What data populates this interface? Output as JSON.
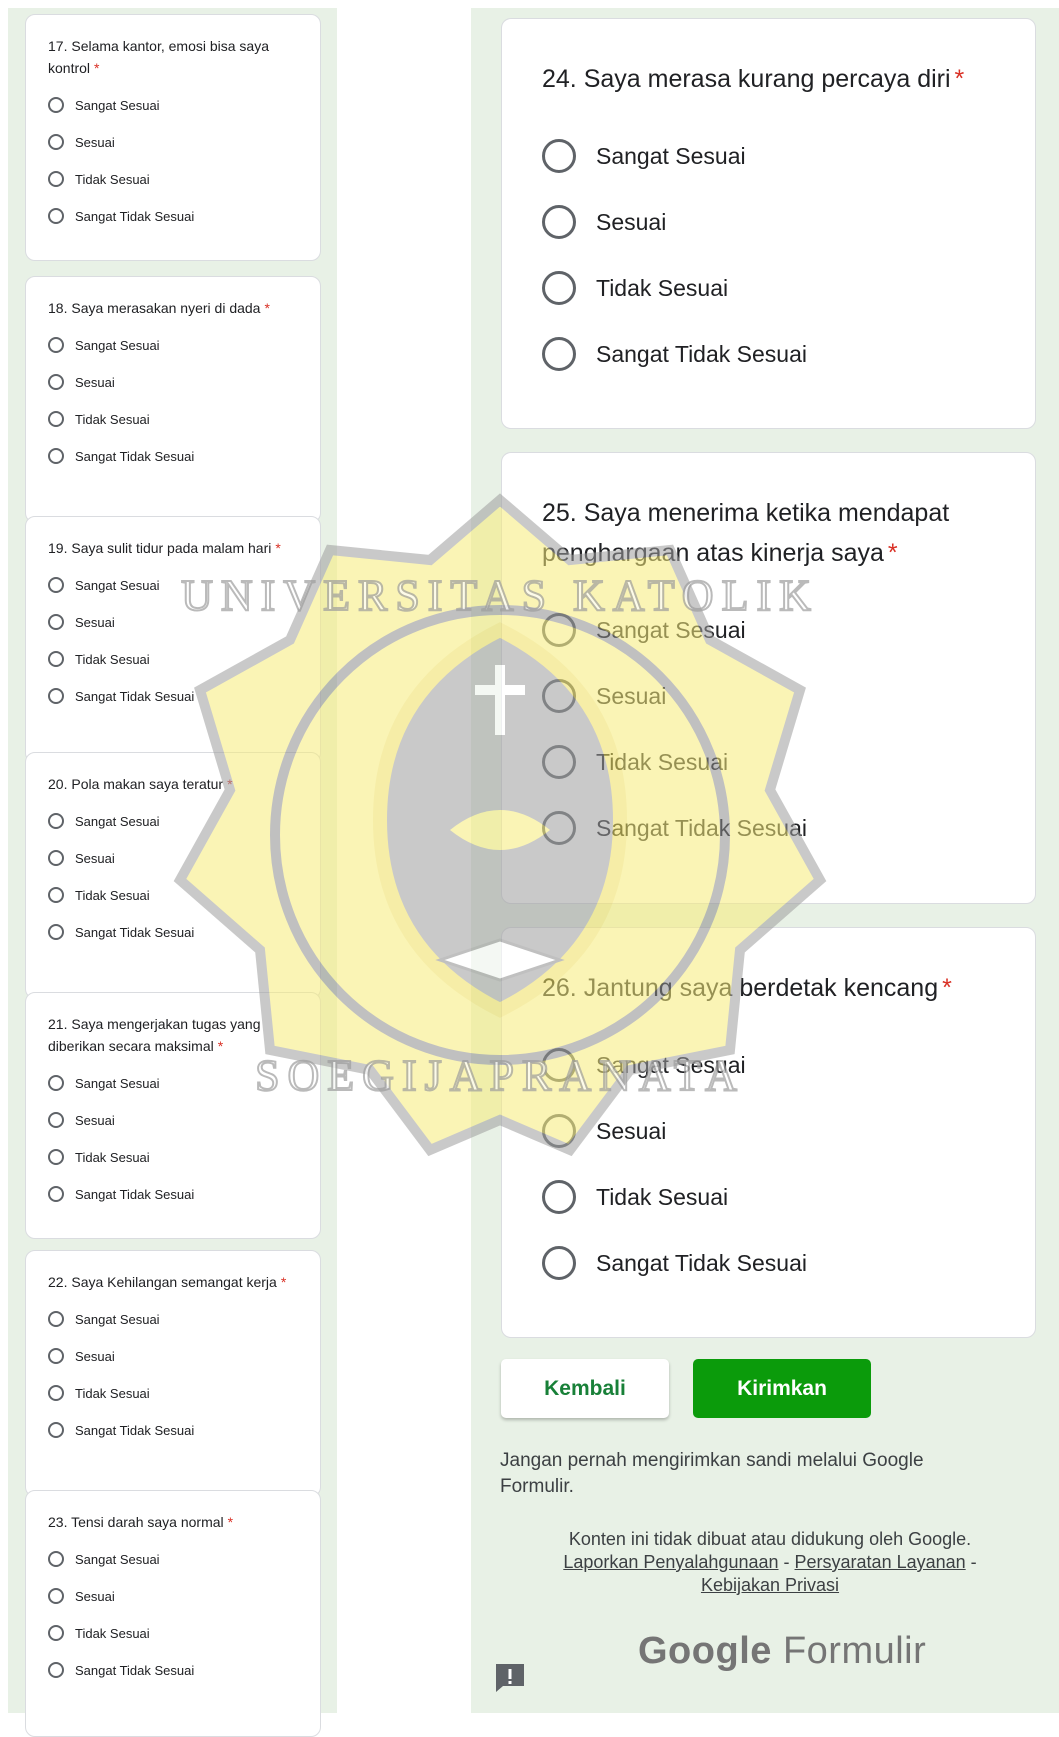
{
  "left_questions": [
    {
      "title_lines": [
        "17. Selama kantor, emosi bisa saya",
        "kontrol"
      ],
      "required": "*"
    },
    {
      "title_lines": [
        "18. Saya merasakan nyeri di dada"
      ],
      "required": "*"
    },
    {
      "title_lines": [
        "19. Saya sulit tidur pada malam hari"
      ],
      "required": "*"
    },
    {
      "title_lines": [
        "20. Pola makan saya teratur"
      ],
      "required": "*"
    },
    {
      "title_lines": [
        "21. Saya mengerjakan tugas yang",
        "diberikan secara maksimal"
      ],
      "required": "*"
    },
    {
      "title_lines": [
        "22. Saya Kehilangan semangat kerja"
      ],
      "required": "*"
    },
    {
      "title_lines": [
        "23. Tensi darah saya normal"
      ],
      "required": "*"
    }
  ],
  "right_questions": [
    {
      "title_lines": [
        "24. Saya merasa kurang percaya diri"
      ],
      "required": "*"
    },
    {
      "title_lines": [
        "25. Saya menerima ketika mendapat",
        "penghargaan atas kinerja saya"
      ],
      "required": "*"
    },
    {
      "title_lines": [
        "26. Jantung saya berdetak kencang"
      ],
      "required": "*"
    }
  ],
  "options": [
    "Sangat Sesuai",
    "Sesuai",
    "Tidak Sesuai",
    "Sangat Tidak Sesuai"
  ],
  "buttons": {
    "back": "Kembali",
    "submit": "Kirimkan"
  },
  "warning": "Jangan pernah mengirimkan sandi melalui Google Formulir.",
  "footer": {
    "disclaimer": "Konten ini tidak dibuat atau didukung oleh Google.",
    "link_abuse": "Laporkan Penyalahgunaan",
    "separator": "-",
    "link_terms": "Persyaratan Layanan",
    "link_privacy": "Kebijakan Privasi"
  },
  "brand": {
    "google": "Google",
    "forms": "Formulir"
  },
  "watermark": {
    "text_top": "UNIVERSITAS KATOLIK",
    "text_bottom": "SOEGIJAPRANATA"
  },
  "colors": {
    "accent": "#0b9b0b",
    "required": "#d93025",
    "background": "#e8f1e6"
  }
}
